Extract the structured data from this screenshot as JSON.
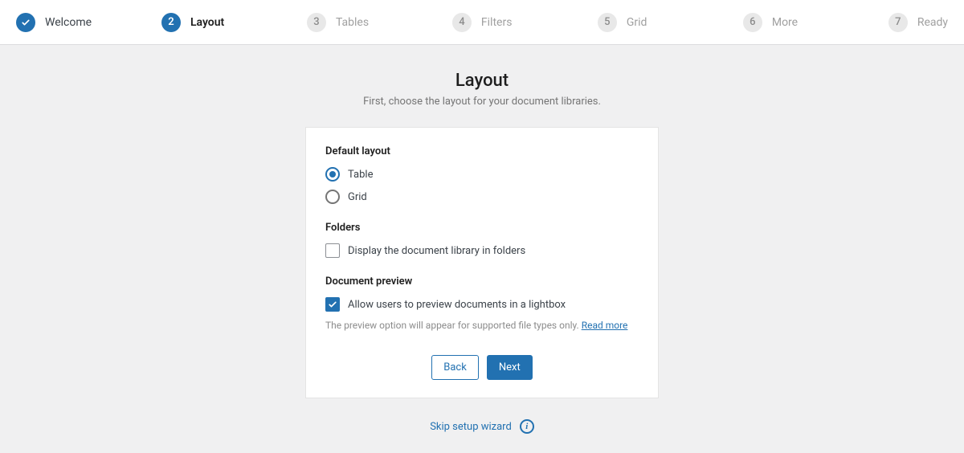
{
  "stepper": [
    {
      "num": "1",
      "label": "Welcome",
      "state": "completed"
    },
    {
      "num": "2",
      "label": "Layout",
      "state": "active"
    },
    {
      "num": "3",
      "label": "Tables",
      "state": "pending"
    },
    {
      "num": "4",
      "label": "Filters",
      "state": "pending"
    },
    {
      "num": "5",
      "label": "Grid",
      "state": "pending"
    },
    {
      "num": "6",
      "label": "More",
      "state": "pending"
    },
    {
      "num": "7",
      "label": "Ready",
      "state": "pending"
    }
  ],
  "page": {
    "title": "Layout",
    "subtitle": "First, choose the layout for your document libraries."
  },
  "sections": {
    "layout": {
      "title": "Default layout",
      "options": {
        "table": "Table",
        "grid": "Grid"
      },
      "selected": "table"
    },
    "folders": {
      "title": "Folders",
      "checkbox_label": "Display the document library in folders",
      "checked": false
    },
    "preview": {
      "title": "Document preview",
      "checkbox_label": "Allow users to preview documents in a lightbox",
      "checked": true,
      "helper": "The preview option will appear for supported file types only. ",
      "read_more": "Read more"
    }
  },
  "actions": {
    "back": "Back",
    "next": "Next"
  },
  "footer": {
    "skip": "Skip setup wizard"
  }
}
